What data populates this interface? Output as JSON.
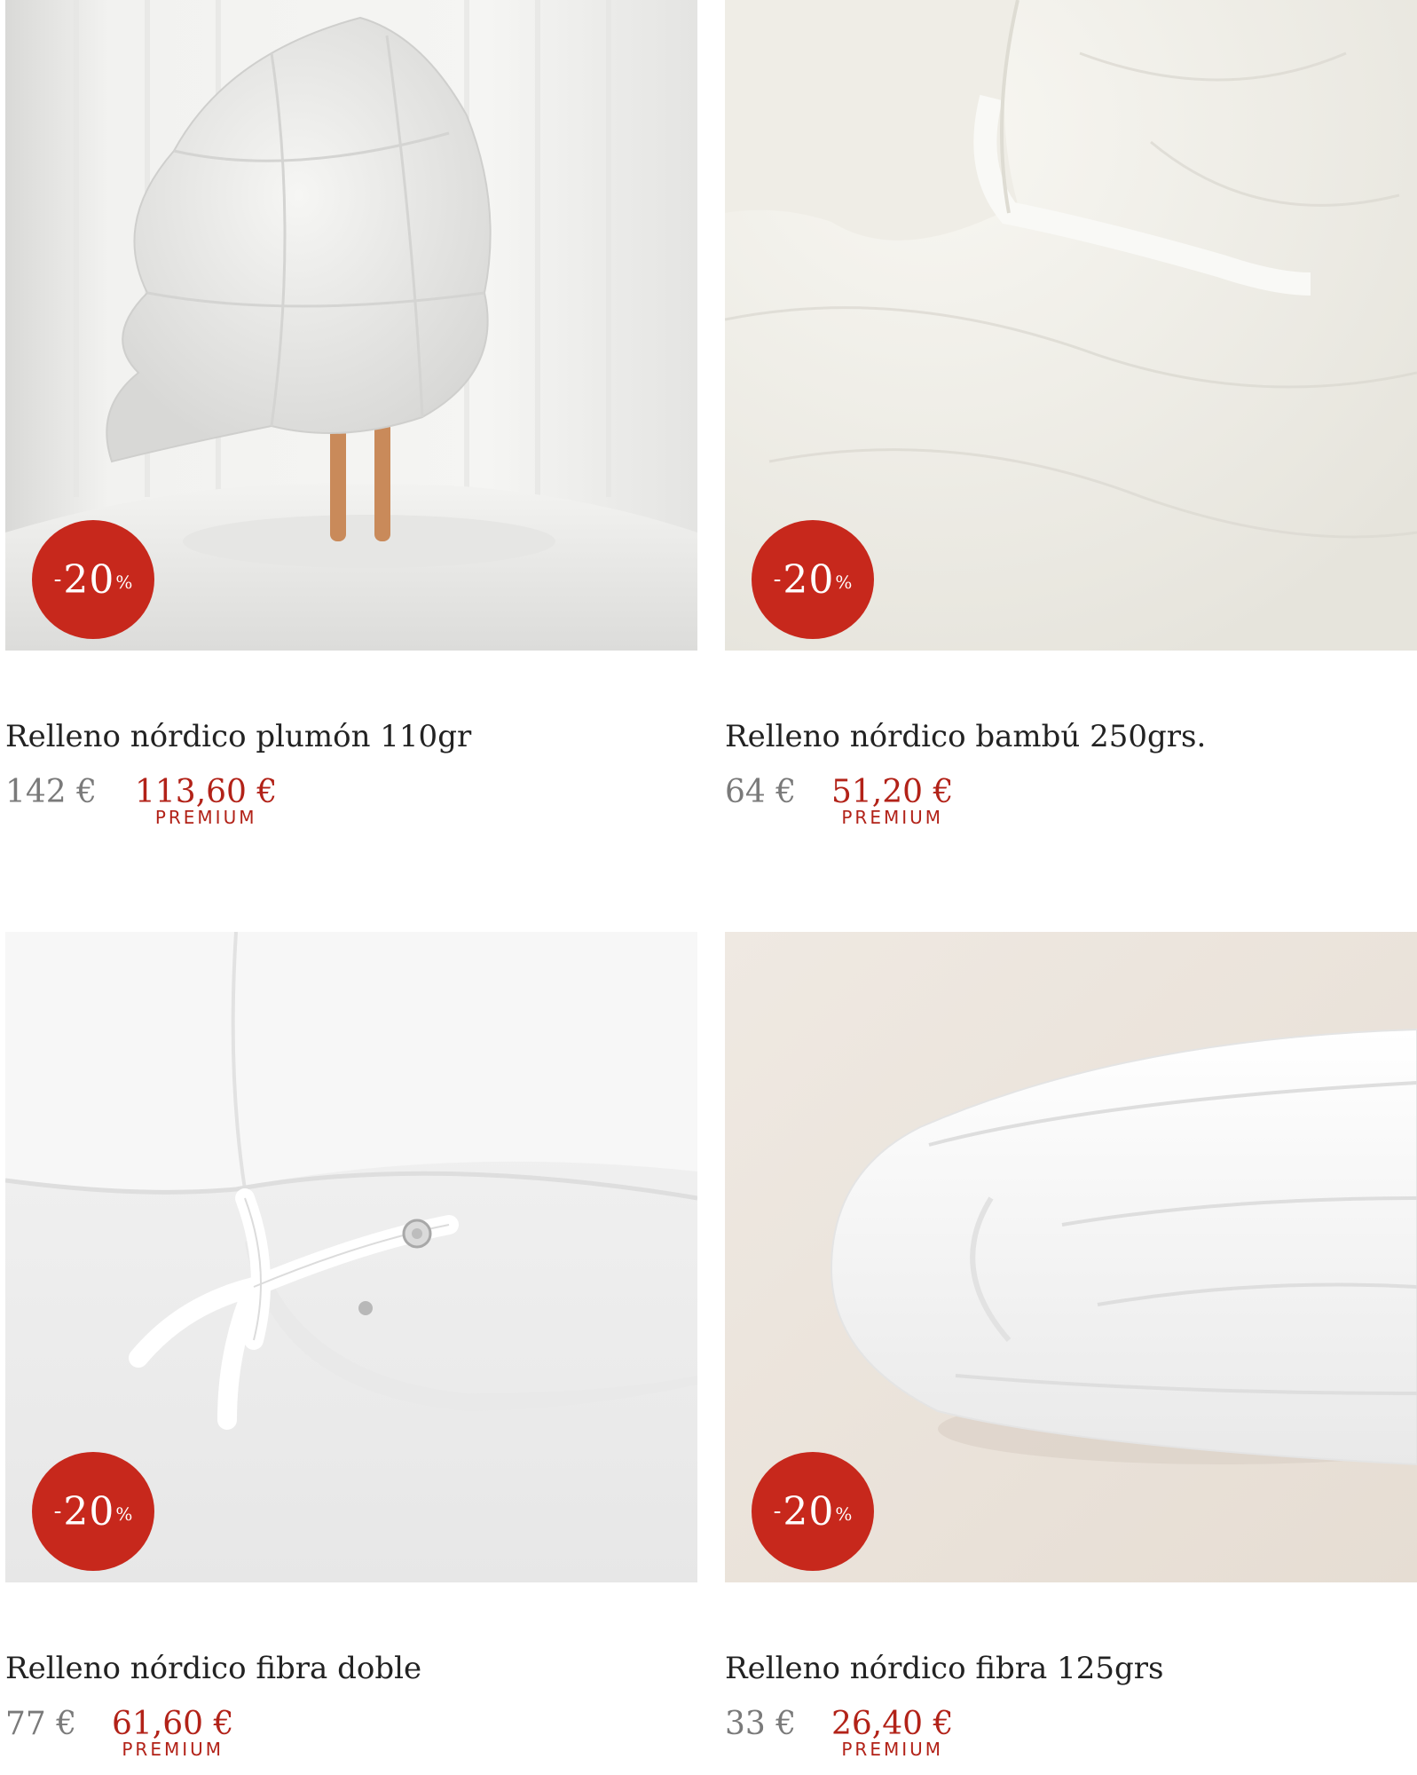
{
  "products": [
    {
      "title": "Relleno nórdico plumón 110gr",
      "old_price": "142 €",
      "new_price": "113,60 €",
      "tag": "PREMIUM",
      "discount": {
        "minus": "-",
        "number": "20",
        "percent": "%"
      },
      "image": "person-holding-duvet-photo"
    },
    {
      "title": "Relleno nórdico bambú 250grs.",
      "old_price": "64 €",
      "new_price": "51,20 €",
      "tag": "PREMIUM",
      "discount": {
        "minus": "-",
        "number": "20",
        "percent": "%"
      },
      "image": "duvet-corner-closeup-photo"
    },
    {
      "title": "Relleno nórdico fibra doble",
      "old_price": "77 €",
      "new_price": "61,60 €",
      "tag": "PREMIUM",
      "discount": {
        "minus": "-",
        "number": "20",
        "percent": "%"
      },
      "image": "duvet-ribbon-tie-photo"
    },
    {
      "title": "Relleno nórdico fibra 125grs",
      "old_price": "33 €",
      "new_price": "26,40 €",
      "tag": "PREMIUM",
      "discount": {
        "minus": "-",
        "number": "20",
        "percent": "%"
      },
      "image": "folded-duvet-photo"
    }
  ],
  "colors": {
    "badge": "#c7281c",
    "sale_price": "#b22218",
    "old_price": "#7a7a7a",
    "title": "#222222"
  }
}
